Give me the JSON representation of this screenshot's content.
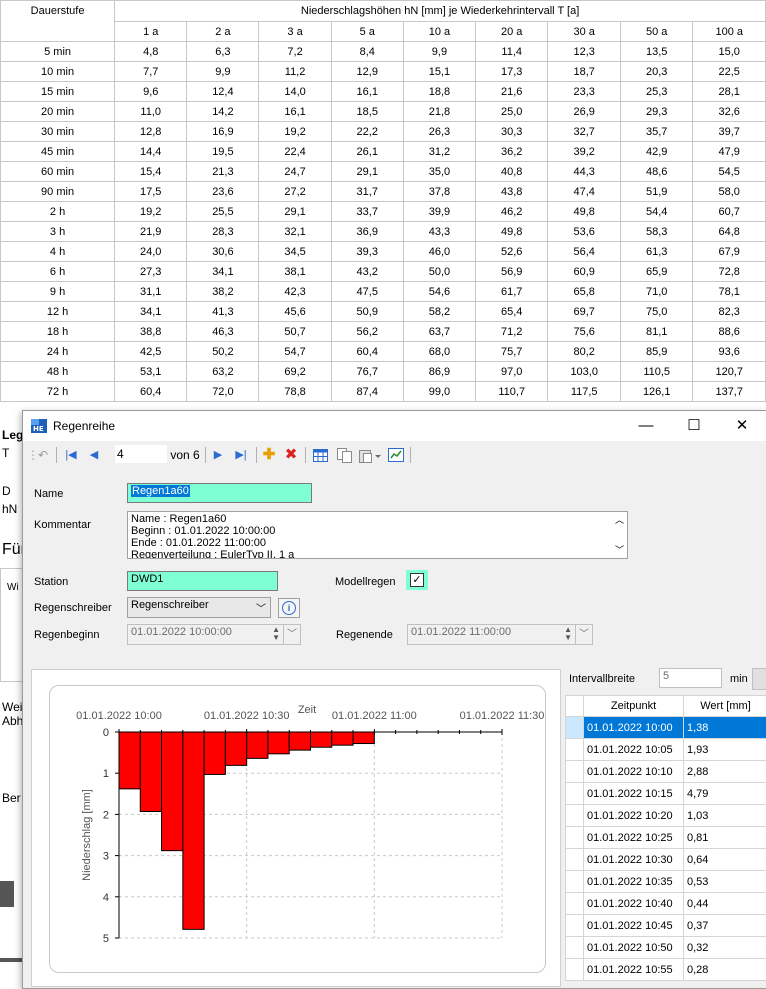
{
  "table": {
    "col0_header": "Dauerstufe",
    "group_header": "Niederschlagshöhen hN [mm] je Wiederkehrintervall T [a]",
    "periods": [
      "1 a",
      "2 a",
      "3 a",
      "5 a",
      "10 a",
      "20 a",
      "30 a",
      "50 a",
      "100 a"
    ],
    "rows": [
      [
        "5 min",
        "4,8",
        "6,3",
        "7,2",
        "8,4",
        "9,9",
        "11,4",
        "12,3",
        "13,5",
        "15,0"
      ],
      [
        "10 min",
        "7,7",
        "9,9",
        "11,2",
        "12,9",
        "15,1",
        "17,3",
        "18,7",
        "20,3",
        "22,5"
      ],
      [
        "15 min",
        "9,6",
        "12,4",
        "14,0",
        "16,1",
        "18,8",
        "21,6",
        "23,3",
        "25,3",
        "28,1"
      ],
      [
        "20 min",
        "11,0",
        "14,2",
        "16,1",
        "18,5",
        "21,8",
        "25,0",
        "26,9",
        "29,3",
        "32,6"
      ],
      [
        "30 min",
        "12,8",
        "16,9",
        "19,2",
        "22,2",
        "26,3",
        "30,3",
        "32,7",
        "35,7",
        "39,7"
      ],
      [
        "45 min",
        "14,4",
        "19,5",
        "22,4",
        "26,1",
        "31,2",
        "36,2",
        "39,2",
        "42,9",
        "47,9"
      ],
      [
        "60 min",
        "15,4",
        "21,3",
        "24,7",
        "29,1",
        "35,0",
        "40,8",
        "44,3",
        "48,6",
        "54,5"
      ],
      [
        "90 min",
        "17,5",
        "23,6",
        "27,2",
        "31,7",
        "37,8",
        "43,8",
        "47,4",
        "51,9",
        "58,0"
      ],
      [
        "2 h",
        "19,2",
        "25,5",
        "29,1",
        "33,7",
        "39,9",
        "46,2",
        "49,8",
        "54,4",
        "60,7"
      ],
      [
        "3 h",
        "21,9",
        "28,3",
        "32,1",
        "36,9",
        "43,3",
        "49,8",
        "53,6",
        "58,3",
        "64,8"
      ],
      [
        "4 h",
        "24,0",
        "30,6",
        "34,5",
        "39,3",
        "46,0",
        "52,6",
        "56,4",
        "61,3",
        "67,9"
      ],
      [
        "6 h",
        "27,3",
        "34,1",
        "38,1",
        "43,2",
        "50,0",
        "56,9",
        "60,9",
        "65,9",
        "72,8"
      ],
      [
        "9 h",
        "31,1",
        "38,2",
        "42,3",
        "47,5",
        "54,6",
        "61,7",
        "65,8",
        "71,0",
        "78,1"
      ],
      [
        "12 h",
        "34,1",
        "41,3",
        "45,6",
        "50,9",
        "58,2",
        "65,4",
        "69,7",
        "75,0",
        "82,3"
      ],
      [
        "18 h",
        "38,8",
        "46,3",
        "50,7",
        "56,2",
        "63,7",
        "71,2",
        "75,6",
        "81,1",
        "88,6"
      ],
      [
        "24 h",
        "42,5",
        "50,2",
        "54,7",
        "60,4",
        "68,0",
        "75,7",
        "80,2",
        "85,9",
        "93,6"
      ],
      [
        "48 h",
        "53,1",
        "63,2",
        "69,2",
        "76,7",
        "86,9",
        "97,0",
        "103,0",
        "110,5",
        "120,7"
      ],
      [
        "72 h",
        "60,4",
        "72,0",
        "78,8",
        "87,4",
        "99,0",
        "110,7",
        "117,5",
        "126,1",
        "137,7"
      ]
    ]
  },
  "background": {
    "frag_leg": "Leg",
    "frag_t": "T",
    "frag_d": "D",
    "frag_hn": "hN",
    "frag_fur": "Für",
    "frag_wi": "Wi",
    "frag_wei": "Wei",
    "frag_abh": "Abh",
    "frag_ber": "Ber"
  },
  "dialog": {
    "title": "Regenreihe",
    "minimize": "—",
    "maximize": "☐",
    "close": "✕",
    "toolbar": {
      "record": "4",
      "of_label": "von 6"
    },
    "name_label": "Name",
    "name_value": "Regen1a60",
    "comment_label": "Kommentar",
    "comment_lines": [
      "Name : Regen1a60",
      "Beginn : 01.01.2022 10:00:00",
      "Ende : 01.01.2022 11:00:00",
      "Regenverteilung : EulerTyp II, 1 a"
    ],
    "station_label": "Station",
    "station_value": "DWD1",
    "model_label": "Modellregen",
    "model_checked": true,
    "writer_label": "Regenschreiber",
    "writer_value": "Regenschreiber",
    "start_label": "Regenbeginn",
    "start_value": "01.01.2022  10:00:00",
    "end_label": "Regenende",
    "end_value": "01.01.2022  11:00:00",
    "interval_label": "Intervallbreite",
    "interval_value": "5",
    "interval_unit": "min",
    "grid": {
      "col_time": "Zeitpunkt",
      "col_value": "Wert [mm]",
      "rows": [
        [
          "01.01.2022 10:00",
          "1,38"
        ],
        [
          "01.01.2022 10:05",
          "1,93"
        ],
        [
          "01.01.2022 10:10",
          "2,88"
        ],
        [
          "01.01.2022 10:15",
          "4,79"
        ],
        [
          "01.01.2022 10:20",
          "1,03"
        ],
        [
          "01.01.2022 10:25",
          "0,81"
        ],
        [
          "01.01.2022 10:30",
          "0,64"
        ],
        [
          "01.01.2022 10:35",
          "0,53"
        ],
        [
          "01.01.2022 10:40",
          "0,44"
        ],
        [
          "01.01.2022 10:45",
          "0,37"
        ],
        [
          "01.01.2022 10:50",
          "0,32"
        ],
        [
          "01.01.2022 10:55",
          "0,28"
        ]
      ]
    }
  },
  "chart_data": {
    "type": "bar",
    "title": "",
    "xlabel": "Zeit",
    "ylabel": "Niederschlag [mm]",
    "x_tick_labels": [
      "01.01.2022 10:00",
      "01.01.2022 10:30",
      "01.01.2022 11:00",
      "01.01.2022 11:30"
    ],
    "x_range_minutes": [
      0,
      90
    ],
    "y_ticks": [
      "0",
      "1",
      "2",
      "3",
      "4",
      "5"
    ],
    "ylim": [
      0,
      5
    ],
    "y_inverted": true,
    "bar_color": "#ff0000",
    "categories": [
      "10:00",
      "10:05",
      "10:10",
      "10:15",
      "10:20",
      "10:25",
      "10:30",
      "10:35",
      "10:40",
      "10:45",
      "10:50",
      "10:55"
    ],
    "values": [
      1.38,
      1.93,
      2.88,
      4.79,
      1.03,
      0.81,
      0.64,
      0.53,
      0.44,
      0.37,
      0.32,
      0.28
    ]
  }
}
